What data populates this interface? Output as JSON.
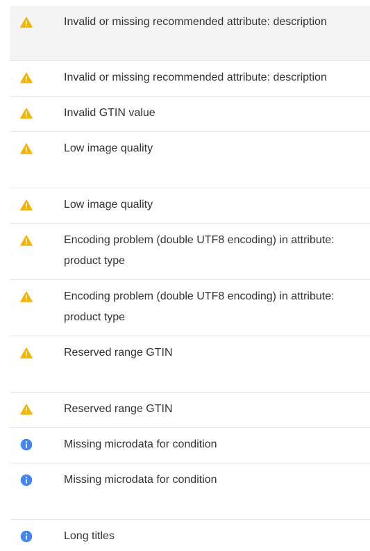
{
  "colors": {
    "warning": "#f4b400",
    "info": "#4285f4",
    "text": "#333333",
    "divider": "#e6e6e6",
    "highlight_bg": "#f4f4f4"
  },
  "issues": [
    {
      "icon": "warning-icon",
      "label": "Invalid or missing recommended attribute: description"
    },
    {
      "icon": "warning-icon",
      "label": "Invalid or missing recommended attribute: description"
    },
    {
      "icon": "warning-icon",
      "label": "Invalid GTIN value"
    },
    {
      "icon": "warning-icon",
      "label": "Low image quality"
    },
    {
      "icon": "warning-icon",
      "label": "Low image quality"
    },
    {
      "icon": "warning-icon",
      "label": "Encoding problem (double UTF8 encoding) in attribute: product type"
    },
    {
      "icon": "warning-icon",
      "label": "Encoding problem (double UTF8 encoding) in attribute: product type"
    },
    {
      "icon": "warning-icon",
      "label": "Reserved range GTIN"
    },
    {
      "icon": "warning-icon",
      "label": "Reserved range GTIN"
    },
    {
      "icon": "info-icon",
      "label": "Missing microdata for condition"
    },
    {
      "icon": "info-icon",
      "label": "Missing microdata for condition"
    },
    {
      "icon": "info-icon",
      "label": "Long titles"
    }
  ]
}
